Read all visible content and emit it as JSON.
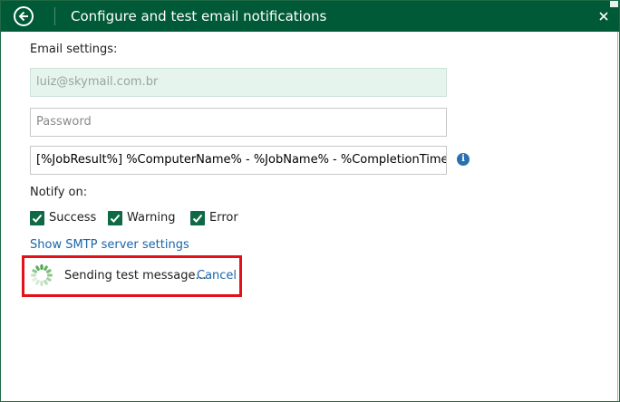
{
  "dialog": {
    "title": "Configure and test email notifications"
  },
  "email_settings": {
    "section_label": "Email settings:",
    "email_value": "luiz@skymail.com.br",
    "password_placeholder": "Password",
    "subject_value": "[%JobResult%] %ComputerName% - %JobName% - %CompletionTime%"
  },
  "notify": {
    "label": "Notify on:",
    "options": [
      {
        "label": "Success",
        "checked": true
      },
      {
        "label": "Warning",
        "checked": true
      },
      {
        "label": "Error",
        "checked": true
      }
    ]
  },
  "links": {
    "smtp_settings": "Show SMTP server settings"
  },
  "status": {
    "sending_text": "Sending test message...",
    "cancel_label": "Cancel"
  },
  "colors": {
    "title_bar": "#005a37",
    "checkbox": "#0e6a44",
    "link": "#1a66aa",
    "highlight": "#e3111b"
  }
}
